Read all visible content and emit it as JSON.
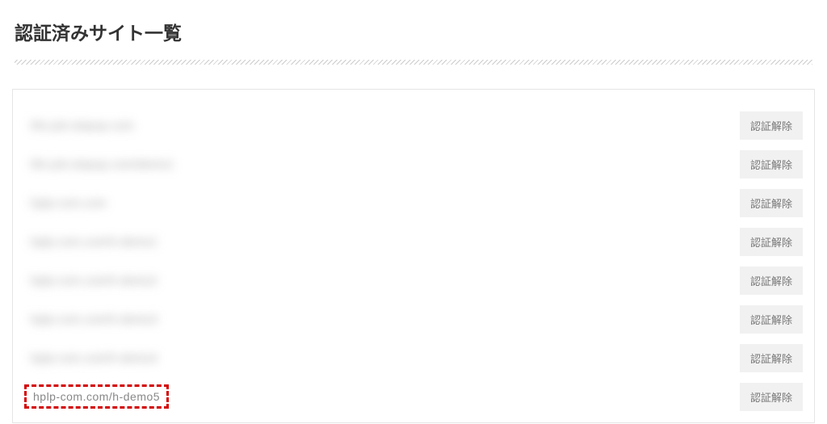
{
  "title": "認証済みサイト一覧",
  "revoke_label": "認証解除",
  "sites": [
    {
      "label": "life-job-stepup.com",
      "blurred": true,
      "highlight": false
    },
    {
      "label": "life-job-stepup.com/demo1",
      "blurred": true,
      "highlight": false
    },
    {
      "label": "hplp-com.com",
      "blurred": true,
      "highlight": false
    },
    {
      "label": "hplp-com.com/h-demo1",
      "blurred": true,
      "highlight": false
    },
    {
      "label": "hplp-com.com/h-demo2",
      "blurred": true,
      "highlight": false
    },
    {
      "label": "hplp-com.com/h-demo3",
      "blurred": true,
      "highlight": false
    },
    {
      "label": "hplp-com.com/h-demo4",
      "blurred": true,
      "highlight": false
    },
    {
      "label": "hplp-com.com/h-demo5",
      "blurred": false,
      "highlight": true
    }
  ]
}
